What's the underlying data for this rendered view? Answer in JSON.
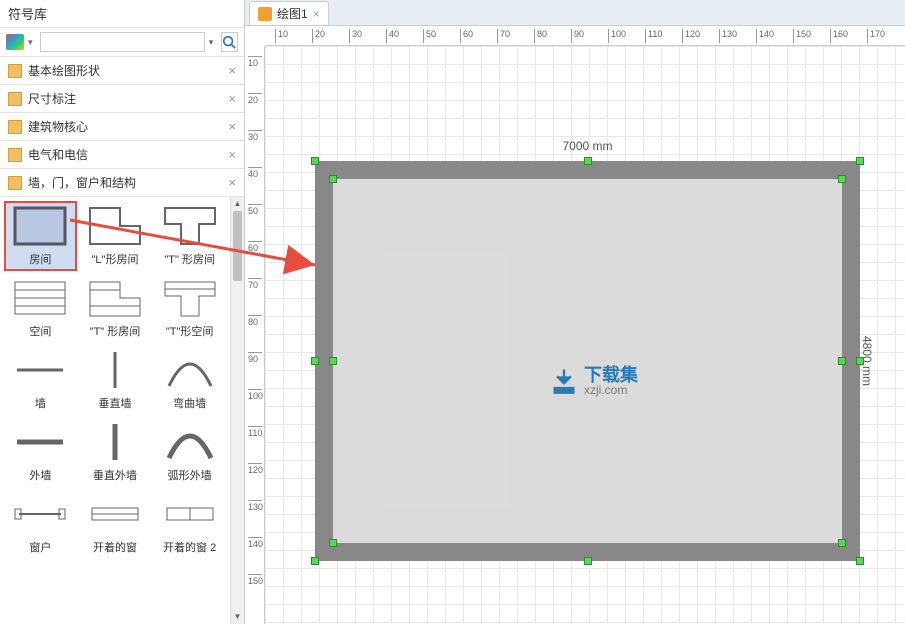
{
  "sidebar": {
    "title": "符号库",
    "search_placeholder": "",
    "categories": [
      {
        "label": "基本绘图形状"
      },
      {
        "label": "尺寸标注"
      },
      {
        "label": "建筑物核心"
      },
      {
        "label": "电气和电信"
      },
      {
        "label": "墙，门，窗户和结构"
      }
    ],
    "shapes": [
      {
        "label": "房间"
      },
      {
        "label": "\"L\"形房间"
      },
      {
        "label": "\"T\" 形房间"
      },
      {
        "label": "空间"
      },
      {
        "label": "\"T\" 形房间"
      },
      {
        "label": "\"T\"形空间"
      },
      {
        "label": "墙"
      },
      {
        "label": "垂直墙"
      },
      {
        "label": "弯曲墙"
      },
      {
        "label": "外墙"
      },
      {
        "label": "垂直外墙"
      },
      {
        "label": "弧形外墙"
      },
      {
        "label": "窗户"
      },
      {
        "label": "开着的窗"
      },
      {
        "label": "开着的窗 2"
      }
    ]
  },
  "tab": {
    "label": "绘图1",
    "close": "×"
  },
  "ruler_h": [
    "10",
    "20",
    "30",
    "40",
    "50",
    "60",
    "70",
    "80",
    "90",
    "100",
    "110",
    "120",
    "130",
    "140",
    "150",
    "160",
    "170"
  ],
  "ruler_v": [
    "10",
    "20",
    "30",
    "40",
    "50",
    "60",
    "70",
    "80",
    "90",
    "100",
    "110",
    "120",
    "130",
    "140",
    "150"
  ],
  "room": {
    "width_label": "7000 mm",
    "height_label": "4800 mm"
  },
  "watermark": {
    "cn": "下载集",
    "en": "xzji.com"
  }
}
